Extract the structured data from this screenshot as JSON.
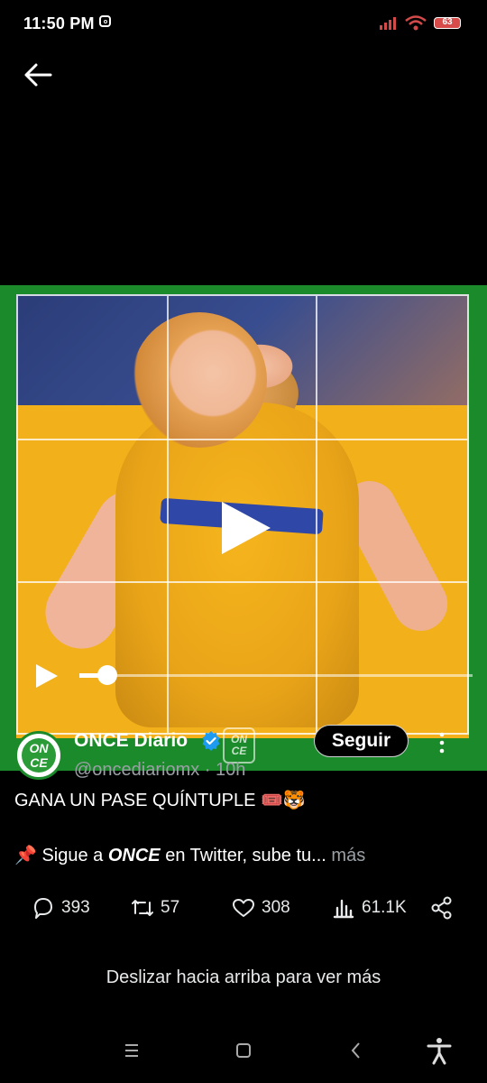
{
  "status_bar": {
    "time": "11:50 PM",
    "battery": "63"
  },
  "author": {
    "name": "ONCE Diario",
    "handle": "@oncediariomx · 10h",
    "avatar_text": "ON CE",
    "affiliate_text": "ON CE",
    "follow_label": "Seguir"
  },
  "tweet": {
    "line1": "GANA UN PASE QUÍNTUPLE 🎟️🐯",
    "line2_prefix": "📌 Sigue a ",
    "line2_bold": "ONCE",
    "line2_suffix": " en Twitter, sube tu...",
    "more_label": "más"
  },
  "actions": {
    "replies": "393",
    "retweets": "57",
    "likes": "308",
    "views": "61.1K"
  },
  "video": {
    "progress": 0.07
  },
  "swipe_hint": "Deslizar hacia arriba para ver más",
  "colors": {
    "accent_green": "#1b8a2a",
    "verified_blue": "#1d9bf0"
  }
}
